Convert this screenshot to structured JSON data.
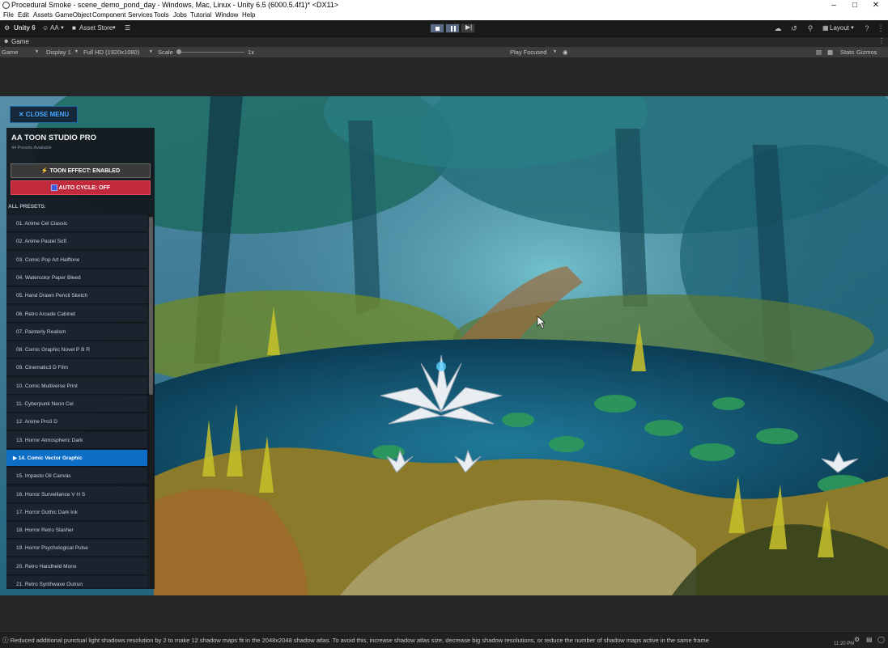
{
  "window": {
    "title": "Procedural Smoke - scene_demo_pond_day - Windows, Mac, Linux - Unity 6.5 (6000.5.4f1)* <DX11>"
  },
  "menu": [
    "File",
    "Edit",
    "Assets",
    "GameObject",
    "Component",
    "Services",
    "Tools",
    "Jobs",
    "Tutorial",
    "Window",
    "Help"
  ],
  "toolbar": {
    "unity": "Unity 6",
    "account": "AA",
    "asset_store": "Asset Store",
    "layout": "Layout"
  },
  "tab": {
    "label": "Game"
  },
  "game_controls": {
    "mode": "Game",
    "display": "Display 1",
    "resolution": "Full HD (1920x1080)",
    "scale_label": "Scale",
    "scale_value": "1x",
    "play_focused": "Play Focused",
    "stats": "Stats",
    "gizmos": "Gizmos"
  },
  "overlay": {
    "close_menu": "✕ CLOSE MENU",
    "title": "AA TOON STUDIO PRO",
    "subtitle": "44 Presets Available",
    "toon_effect": "TOON EFFECT: ENABLED",
    "auto_cycle": "AUTO CYCLE: OFF",
    "all_presets": "ALL PRESETS:",
    "selected_index": 13,
    "presets": [
      "01. Anime Cel Classic",
      "02. Anime Pastel Soft",
      "03. Comic Pop Art Halftone",
      "04. Watercolor Paper Bleed",
      "05. Hand Drawn Pencil Sketch",
      "06. Retro Arcade Cabinet",
      "07. Painterly Realism",
      "08. Comic Graphic Novel P B R",
      "09. Cinematic3 D Film",
      "10. Comic Multiverse Print",
      "11. Cyberpunk Neon Cel",
      "12. Anime Pro3 D",
      "13. Horror Atmospheric Dark",
      "▶ 14. Comic Vector Graphic",
      "15. Impasto Oil Canvas",
      "16. Horror Surveillance V H S",
      "17. Horror Gothic Dark Ink",
      "18. Horror Retro Slasher",
      "19. Horror Psychological Pulse",
      "20. Retro Handheld Mono",
      "21. Retro Synthwave Outrun"
    ]
  },
  "status": {
    "message": "Reduced additional punctual light shadows resolution by 2 to make 12 shadow maps fit in the 2048x2048 shadow atlas. To avoid this, increase shadow atlas size, decrease big shadow resolutions, or reduce the number of shadow maps active in the same frame",
    "time": "11:20 PM"
  }
}
